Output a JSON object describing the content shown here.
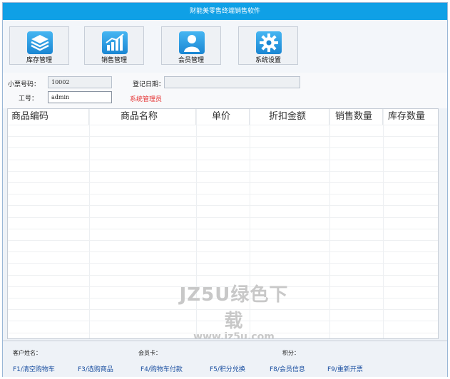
{
  "window": {
    "title": "财能美零售终端销售软件"
  },
  "toolbar": {
    "buttons": [
      {
        "label": "库存管理",
        "icon": "stack-icon"
      },
      {
        "label": "销售管理",
        "icon": "bar-chart-icon"
      },
      {
        "label": "会员管理",
        "icon": "user-icon"
      },
      {
        "label": "系统设置",
        "icon": "gear-icon"
      }
    ]
  },
  "form": {
    "ticket_label": "小票号码：",
    "ticket_value": "10002",
    "date_label": "登记日期：",
    "date_value": "",
    "staff_label": "工号：",
    "staff_value": "admin",
    "role_text": "系统管理员"
  },
  "table": {
    "columns": [
      "商品编码",
      "商品名称",
      "单价",
      "折扣金额",
      "销售数量",
      "库存数量"
    ]
  },
  "watermark": {
    "line1": "JZ5U绿色下载",
    "line2": "www.jz5u.com"
  },
  "footer": {
    "customer_label": "客户姓名：",
    "card_label": "会员卡：",
    "points_label": "积分：",
    "shortcuts": [
      "F1/清空购物车",
      "F3/选购商品",
      "F4/购物车付款",
      "F5/积分兑换",
      "F8/会员信息",
      "F9/重新开票"
    ]
  },
  "colors": {
    "titlebar": "#0fa0e6",
    "accent": "#1a86d3",
    "role": "#e53030",
    "shortcut": "#1a4fa0"
  }
}
